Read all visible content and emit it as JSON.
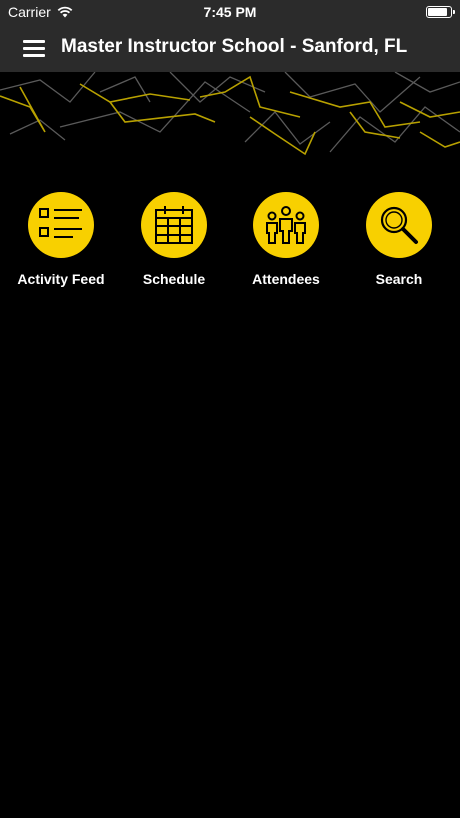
{
  "status_bar": {
    "carrier": "Carrier",
    "time": "7:45 PM",
    "battery_level": 0.9
  },
  "nav": {
    "title": "Master Instructor School - Sanford, FL",
    "menu_icon": "hamburger-icon"
  },
  "colors": {
    "accent": "#f8d000",
    "bar": "#2b2b2b",
    "background": "#000000"
  },
  "tiles": [
    {
      "label": "Activity Feed",
      "icon": "list-icon"
    },
    {
      "label": "Schedule",
      "icon": "calendar-icon"
    },
    {
      "label": "Attendees",
      "icon": "people-icon"
    },
    {
      "label": "Search",
      "icon": "magnifier-icon"
    }
  ]
}
